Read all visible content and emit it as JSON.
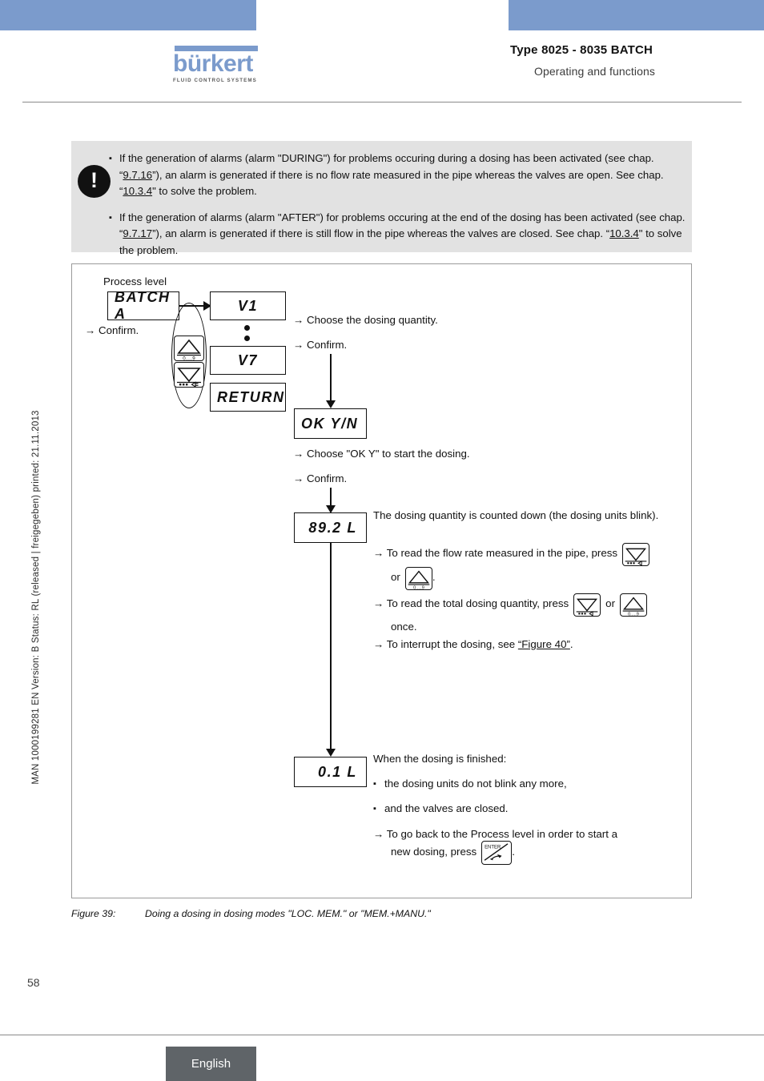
{
  "header": {
    "logo_word": "bürkert",
    "logo_tagline": "FLUID CONTROL SYSTEMS",
    "title": "Type 8025 - 8035 BATCH",
    "subtitle": "Operating and functions",
    "accent_color": "#7b9bcc"
  },
  "sidebar": {
    "vertical_text": "MAN 1000199281  EN  Version: B  Status: RL (released | freigegeben)  printed: 21.11.2013"
  },
  "note": {
    "icon": "exclamation-icon",
    "icon_glyph": "!",
    "background": "#e2e2e2",
    "items": [
      {
        "bullet": "▪",
        "p1": "If the generation of alarms (alarm \"DURING\") for problems occuring during a dosing has been activated (see chap. “",
        "link1": "9.7.16",
        "p2": "”), an alarm is generated if there is no flow rate measured in the pipe whereas the valves are open. See chap. “",
        "link2": "10.3.4",
        "p3": "\" to solve the problem."
      },
      {
        "bullet": "▪",
        "p1": "If the generation of alarms (alarm \"AFTER\") for problems occuring at the end of the dosing has been activated (see chap. “",
        "link1": "9.7.17",
        "p2": "”), an alarm is generated if there is still flow in the pipe whereas the valves are closed. See chap. “",
        "link2": "10.3.4",
        "p3": "\" to solve the problem."
      }
    ]
  },
  "figure": {
    "process_level_label": "Process level",
    "confirm_left": "→ Confirm.",
    "displays": {
      "batch": "BATCH A",
      "v1": "V1",
      "v7": "V7",
      "return": "RETURN",
      "ok_yn": "OK Y/N",
      "counting": "89.2  L",
      "finished": "0.1  L"
    },
    "keys": {
      "up": "up-arrow-key",
      "up_label": "0.....9",
      "down": "down-arrow-key",
      "down_label": "••••⇦",
      "enter": "enter-key",
      "enter_label": "ENTER"
    },
    "step_choose_quantity": "→ Choose the dosing quantity.",
    "step_confirm_1": "→ Confirm.",
    "step_choose_ok": "→ Choose \"OK Y\" to start the dosing.",
    "step_confirm_2": "→ Confirm.",
    "counting_text": "The dosing quantity is counted down (the dosing units blink).",
    "read_flow_pre": "→ To read the flow rate measured in the pipe, press",
    "read_flow_mid": "or",
    "read_flow_end": ".",
    "read_total_pre": "→ To read the total dosing quantity, press",
    "read_total_mid": "or",
    "read_total_end": "once.",
    "interrupt_pre": "→ To interrupt the dosing, see ",
    "interrupt_link": "“Figure 40”",
    "interrupt_end": ".",
    "finished_title": "When the dosing is finished:",
    "finished_b1": "the dosing units do not blink any more,",
    "finished_b2": "and the valves are closed.",
    "goback_pre": "→ To go back to the Process level in order to start a",
    "goback_mid": "new dosing, press",
    "goback_end": "."
  },
  "caption": {
    "number": "Figure 39:",
    "text": "Doing a dosing in dosing modes \"LOC. MEM.\" or \"MEM.+MANU.\""
  },
  "footer": {
    "page_number": "58",
    "language": "English",
    "tab_color": "#5f6468"
  }
}
